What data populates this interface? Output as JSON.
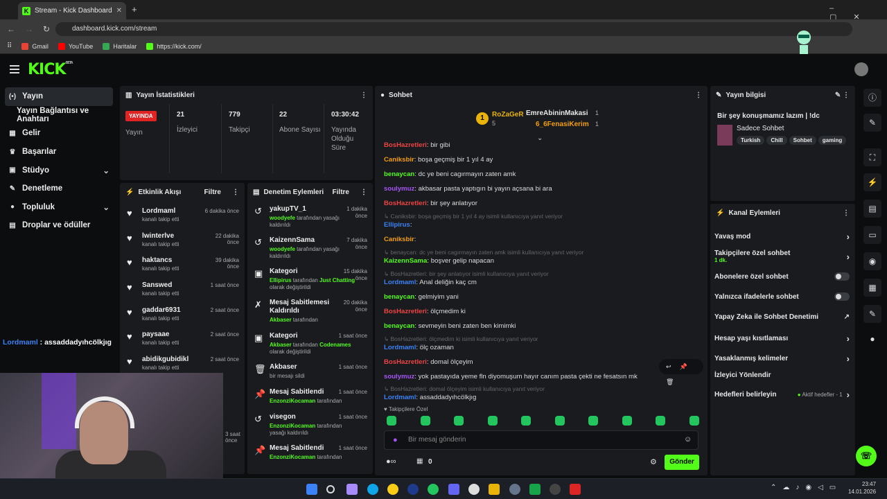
{
  "browser": {
    "tab_title": "Stream - Kick Dashboard",
    "url": "dashboard.kick.com/stream",
    "bookmarks": [
      {
        "label": "Gmail",
        "color": "#ea4335"
      },
      {
        "label": "YouTube",
        "color": "#ff0000"
      },
      {
        "label": "Haritalar",
        "color": "#34a853"
      },
      {
        "label": "https://kick.com/",
        "color": "#53fc18"
      }
    ]
  },
  "brand": {
    "logo": "KICK",
    "beta": "BETA",
    "accent": "#53fc18"
  },
  "nav": {
    "items": [
      {
        "label": "Yayın",
        "icon": "broadcast-icon",
        "glyph": "(•)"
      },
      {
        "label": "Yayın Bağlantısı ve Anahtarı",
        "icon": "",
        "glyph": ""
      },
      {
        "label": "Gelir",
        "icon": "wallet-icon",
        "glyph": "▦"
      },
      {
        "label": "Başarılar",
        "icon": "trophy-icon",
        "glyph": "♛"
      },
      {
        "label": "Stüdyo",
        "icon": "studio-icon",
        "glyph": "▣"
      },
      {
        "label": "Denetleme",
        "icon": "wrench-icon",
        "glyph": "✎"
      },
      {
        "label": "Topluluk",
        "icon": "people-icon",
        "glyph": "●"
      },
      {
        "label": "Droplar ve ödüller",
        "icon": "gift-icon",
        "glyph": "▤"
      }
    ]
  },
  "overlay_chat": {
    "user": "Lordmaml",
    "text": " : assaddadyıhcölkjıg"
  },
  "stats": {
    "title": "Yayın İstatistikleri",
    "live": "YAYINDA",
    "live_label": "Yayın",
    "items": [
      {
        "value": "21",
        "label": "İzleyici"
      },
      {
        "value": "779",
        "label": "Takipçi"
      },
      {
        "value": "22",
        "label": "Abone Sayısı"
      },
      {
        "value": "03:30:42",
        "label": "Yayında Olduğu Süre"
      }
    ]
  },
  "activity": {
    "title": "Etkinlik Akışı",
    "filter": "Filtre",
    "items": [
      {
        "name": "Lordmaml",
        "sub": "kanalı takip etti",
        "time": "6 dakika önce"
      },
      {
        "name": "lwinterlve",
        "sub": "kanalı takip etti",
        "time": "22 dakika önce"
      },
      {
        "name": "haktancs",
        "sub": "kanalı takip etti",
        "time": "39 dakika önce"
      },
      {
        "name": "Sanswed",
        "sub": "kanalı takip etti",
        "time": "1 saat önce"
      },
      {
        "name": "gaddar6931",
        "sub": "kanalı takip etti",
        "time": "2 saat önce"
      },
      {
        "name": "paysaae",
        "sub": "kanalı takip etti",
        "time": "2 saat önce"
      },
      {
        "name": "abidikgubidikl",
        "sub": "kanalı takip etti",
        "time": "2 saat önce"
      }
    ],
    "hidden_time": "3 saat önce"
  },
  "audit": {
    "title": "Denetim Eylemleri",
    "filter": "Filtre",
    "items": [
      {
        "icon": "↺",
        "name": "yakupTV_1",
        "actor": "woodyefe",
        "rest": " tarafından yasağı kaldırıldı",
        "extra": "",
        "extra2": "",
        "time": "1 dakika önce"
      },
      {
        "icon": "↺",
        "name": "KaizennSama",
        "actor": "woodyefe",
        "rest": " tarafından yasağı kaldırıldı",
        "extra": "",
        "extra2": "",
        "time": "7 dakika önce"
      },
      {
        "icon": "▣",
        "name": "Kategori",
        "actor": "Ellipirus",
        "rest": " tarafından ",
        "extra": "Just Chatting",
        "extra2": " olarak değiştirildi",
        "time": "15 dakika önce"
      },
      {
        "icon": "✗",
        "name": "Mesaj Sabitlemesi Kaldırıldı",
        "actor": "Akbaser",
        "rest": " tarafından",
        "extra": "",
        "extra2": "",
        "time": "20 dakika önce"
      },
      {
        "icon": "▣",
        "name": "Kategori",
        "actor": "Akbaser",
        "rest": " tarafından ",
        "extra": "Codenames",
        "extra2": " olarak değiştirildi",
        "time": "1 saat önce"
      },
      {
        "icon": "🗑",
        "name": "Akbaser",
        "actor": "",
        "rest": "bir mesajı sildi",
        "extra": "",
        "extra2": "",
        "time": "1 saat önce"
      },
      {
        "icon": "📌",
        "name": "Mesaj Sabitlendi",
        "actor": "EnzonziKocaman",
        "rest": " tarafından",
        "extra": "",
        "extra2": "",
        "time": "1 saat önce"
      },
      {
        "icon": "↺",
        "name": "visegon",
        "actor": "EnzonziKocaman",
        "rest": " tarafından yasağı kaldırıldı",
        "extra": "",
        "extra2": "",
        "time": "1 saat önce"
      },
      {
        "icon": "📌",
        "name": "Mesaj Sabitlendi",
        "actor": "EnzonziKocaman",
        "rest": " tarafından",
        "extra": "",
        "extra2": "",
        "time": "1 saat önce"
      }
    ]
  },
  "chat": {
    "title": "Sohbet",
    "top": [
      {
        "name": "RoZaGeR",
        "count": "5"
      },
      {
        "name": "EmreAbininMakasi",
        "count": "1"
      },
      {
        "name": "6_6FenasiKerim",
        "count": "1"
      }
    ],
    "messages": [
      {
        "type": "msg",
        "user": "BosHazretleri",
        "color": "u-red",
        "text": "bir gibi"
      },
      {
        "type": "msg",
        "user": "Caniksbir",
        "color": "u-orange",
        "text": "boşa geçmiş bir 1 yıl 4 ay"
      },
      {
        "type": "msg",
        "user": "benaycan",
        "color": "u-green",
        "text": "dc ye beni cagırmayın zaten amk"
      },
      {
        "type": "msg",
        "user": "soulymuz",
        "color": "u-purple",
        "text": "akbasar pasta yaptıgın bi yayın açsana bi ara"
      },
      {
        "type": "msg",
        "user": "BosHazretleri",
        "color": "u-red",
        "text": "bir şey anlatıyor"
      },
      {
        "type": "reply",
        "text": "↳ Caniksbir: boşa geçmiş bir 1 yıl 4 ay isimli kullanıcıya yanıt veriyor"
      },
      {
        "type": "msg",
        "user": "Ellipirus",
        "color": "u-blue",
        "text": ""
      },
      {
        "type": "msg",
        "user": "Caniksbir",
        "color": "u-orange",
        "text": ""
      },
      {
        "type": "reply",
        "text": "↳ benaycan: dc ye beni cagırmayın zaten amk isimli kullanıcıya yanıt veriyor"
      },
      {
        "type": "msg",
        "user": "KaizennSama",
        "color": "u-green",
        "text": "boşver gelip napacan"
      },
      {
        "type": "reply",
        "text": "↳ BosHazretleri: bir şey anlatıyor isimli kullanıcıya yanıt veriyor"
      },
      {
        "type": "msg",
        "user": "Lordmaml",
        "color": "u-blue",
        "text": "Anal deliğin kaç cm"
      },
      {
        "type": "msg",
        "user": "benaycan",
        "color": "u-green",
        "text": "gelmiyim yani"
      },
      {
        "type": "msg",
        "user": "BosHazretleri",
        "color": "u-red",
        "text": "ölçmedim ki"
      },
      {
        "type": "msg",
        "user": "benaycan",
        "color": "u-green",
        "text": "sevmeyin beni zaten ben kimimki"
      },
      {
        "type": "reply",
        "text": "↳ BosHazretleri: ölçmedim ki isimli kullanıcıya yanıt veriyor"
      },
      {
        "type": "msg",
        "user": "Lordmaml",
        "color": "u-blue",
        "text": "ölç ozaman"
      },
      {
        "type": "msg",
        "user": "BosHazretleri",
        "color": "u-red",
        "text": "domal ölçeyim"
      },
      {
        "type": "msg",
        "user": "soulymuz",
        "color": "u-purple",
        "text": "yok pastayıda yeme fln diyomuşum hayır canım pasta çekti ne fesatsın mk"
      },
      {
        "type": "reply",
        "text": "↳ BosHazretleri: domal ölçeyim isimli kullanıcıya yanıt veriyor"
      },
      {
        "type": "msg",
        "user": "Lordmaml",
        "color": "u-blue",
        "text": "assaddadyıhcölkjıg"
      }
    ],
    "followers_only": "Takipçilere Özel",
    "placeholder": "Bir mesaj gönderin",
    "points": "0",
    "send": "Gönder"
  },
  "stream_info": {
    "title": "Yayın bilgisi",
    "stream_title": "Bir şey konuşmamız lazım | !dc",
    "category": "Sadece Sohbet",
    "tags": [
      "Turkish",
      "Chill",
      "Sohbet",
      "gaming"
    ]
  },
  "channel": {
    "title": "Kanal Eylemleri",
    "items": [
      {
        "label": "Yavaş mod",
        "sub": "",
        "ctrl": "chev"
      },
      {
        "label": "Takipçilere özel sohbet",
        "sub": "1 dk.",
        "ctrl": "chev"
      },
      {
        "label": "Abonelere özel sohbet",
        "sub": "",
        "ctrl": "toggle"
      },
      {
        "label": "Yalnızca ifadelerle sohbet",
        "sub": "",
        "ctrl": "toggle"
      },
      {
        "label": "Yapay Zeka ile Sohbet Denetimi",
        "sub": "",
        "ctrl": "ext"
      },
      {
        "label": "Hesap yaşı kısıtlaması",
        "sub": "",
        "ctrl": "chev"
      },
      {
        "label": "Yasaklanmış kelimeler",
        "sub": "",
        "ctrl": "chev"
      },
      {
        "label": "İzleyici Yönlendir",
        "sub": "",
        "ctrl": ""
      },
      {
        "label": "Hedefleri belirleyin",
        "sub": "",
        "ctrl": "goal"
      }
    ],
    "goal_text": "Aktif hedefler - 1"
  },
  "taskbar": {
    "time": "23:47",
    "date": "14.01.2026"
  }
}
